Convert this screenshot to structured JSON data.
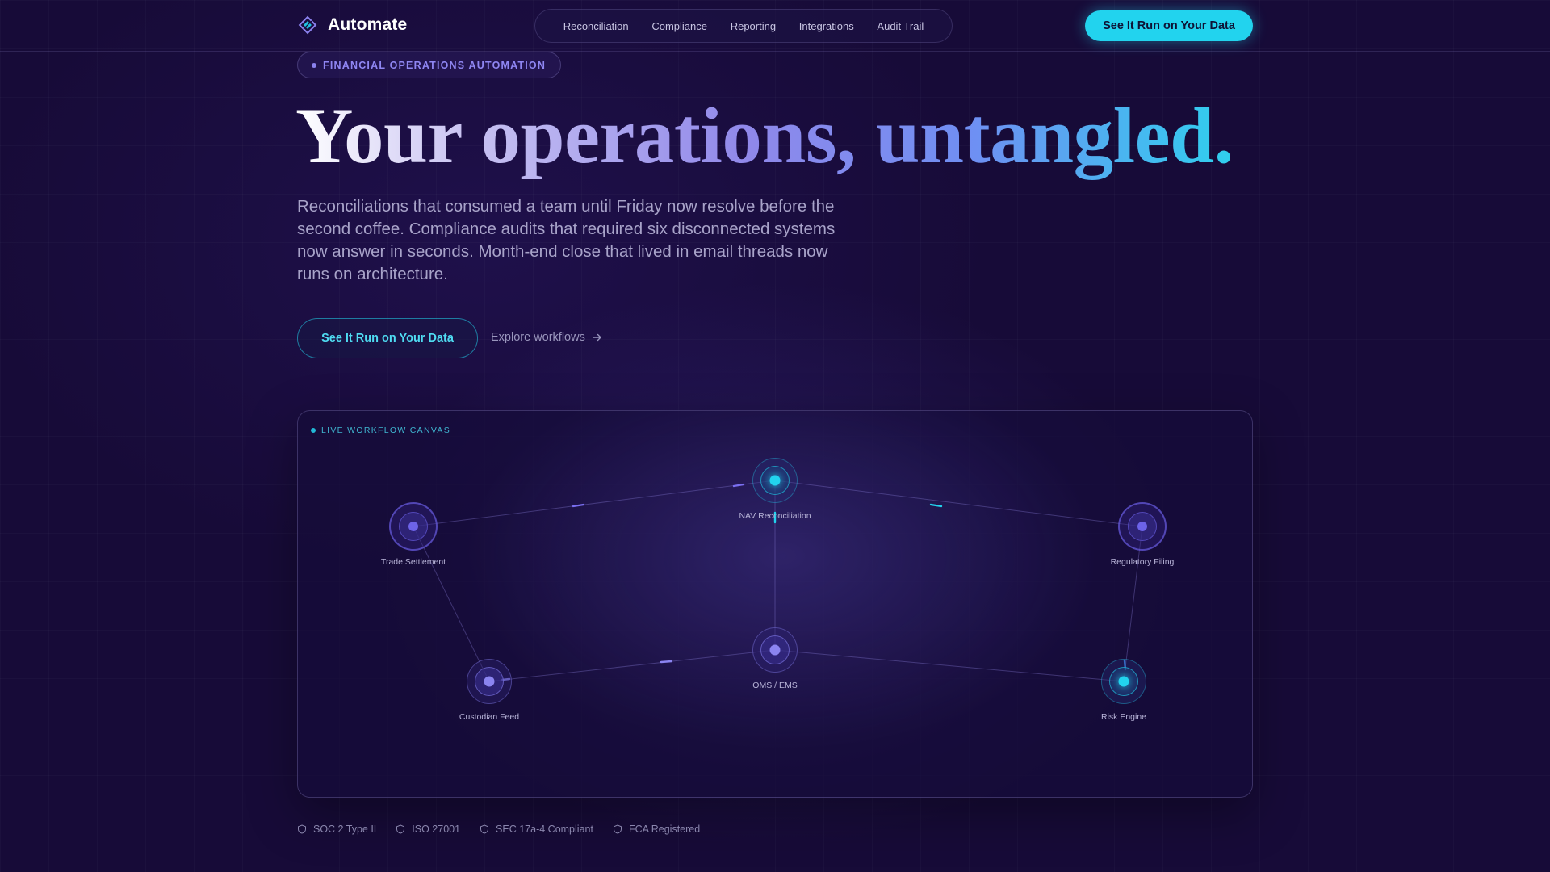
{
  "brand": {
    "name": "Automate",
    "icon": "diamond-logo-icon"
  },
  "nav": {
    "items": [
      "Reconciliation",
      "Compliance",
      "Reporting",
      "Integrations",
      "Audit Trail"
    ]
  },
  "header_cta": "See It Run on Your Data",
  "hero": {
    "eyebrow": "FINANCIAL OPERATIONS AUTOMATION",
    "headline": "Your operations, untangled.",
    "lead": "Reconciliations that consumed a team until Friday now resolve before the second coffee. Compliance audits that required six disconnected systems now answer in seconds. Month-end close that lived in email threads now runs on architecture.",
    "primary_cta": "See It Run on Your Data",
    "secondary_cta": "Explore workflows",
    "secondary_icon": "arrow-right-icon"
  },
  "canvas": {
    "label": "LIVE WORKFLOW CANVAS",
    "nodes": [
      {
        "id": "nav",
        "label": "NAV Reconciliation",
        "accent": "#22d3ee"
      },
      {
        "id": "trade",
        "label": "Trade Settlement",
        "accent": "#6d63e8"
      },
      {
        "id": "reg",
        "label": "Regulatory Filing",
        "accent": "#6d63e8"
      },
      {
        "id": "oms",
        "label": "OMS / EMS",
        "accent": "#8b84f0"
      },
      {
        "id": "custodian",
        "label": "Custodian Feed",
        "accent": "#8b84f0"
      },
      {
        "id": "risk",
        "label": "Risk Engine",
        "accent": "#22d3ee"
      }
    ]
  },
  "trust_badges": [
    {
      "label": "SOC 2 Type II",
      "icon": "shield-icon"
    },
    {
      "label": "ISO 27001",
      "icon": "shield-icon"
    },
    {
      "label": "SEC 17a-4 Compliant",
      "icon": "shield-icon"
    },
    {
      "label": "FCA Registered",
      "icon": "shield-icon"
    }
  ],
  "colors": {
    "background": "#170b38",
    "accent_cyan": "#22d3ee",
    "accent_violet": "#8f86f2"
  }
}
